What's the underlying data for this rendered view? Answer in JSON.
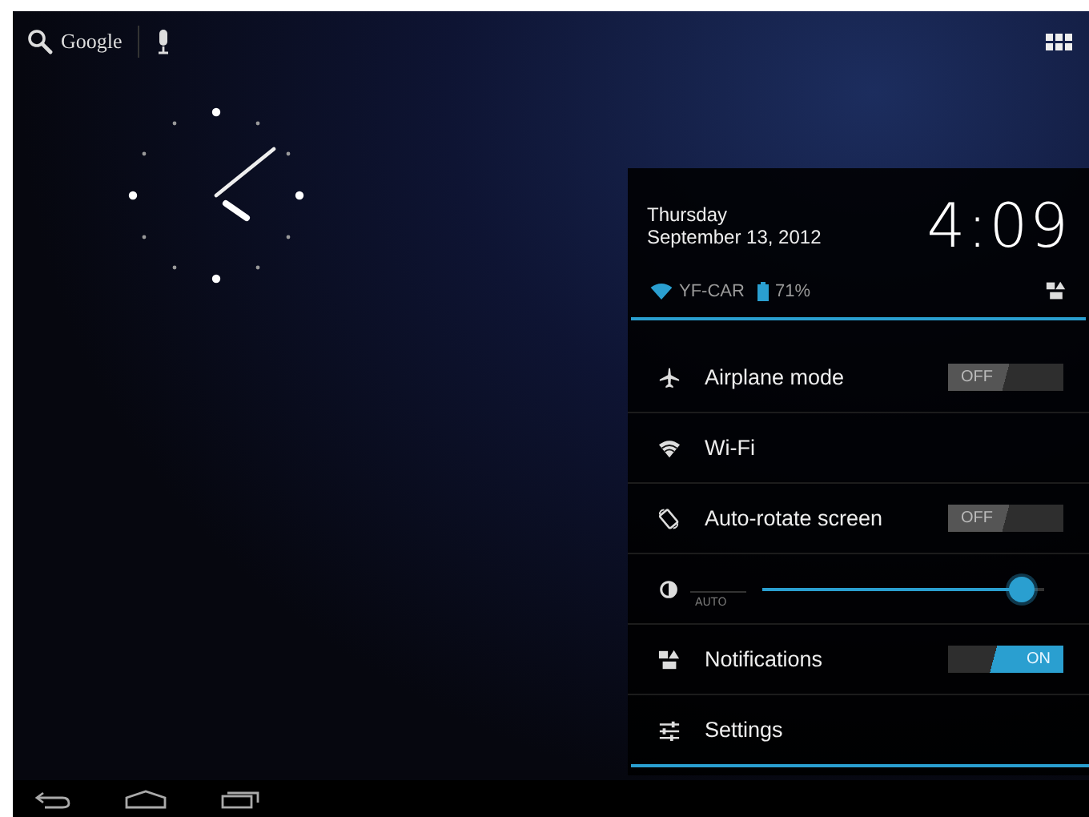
{
  "top_bar": {
    "search_label": "Google"
  },
  "panel": {
    "day": "Thursday",
    "date": "September 13, 2012",
    "time": "4:09",
    "network": "YF-CAR",
    "battery": "71%",
    "rows": [
      {
        "kind": "toggle",
        "label": "Airplane mode",
        "switch_text": "OFF",
        "on": false
      },
      {
        "kind": "plain",
        "label": "Wi-Fi"
      },
      {
        "kind": "toggle",
        "label": "Auto-rotate screen",
        "switch_text": "OFF",
        "on": false
      },
      {
        "kind": "brightness",
        "auto_label": "AUTO",
        "level": 0.92
      },
      {
        "kind": "toggle",
        "label": "Notifications",
        "switch_text": "ON",
        "on": true
      },
      {
        "kind": "plain",
        "label": "Settings"
      }
    ]
  }
}
